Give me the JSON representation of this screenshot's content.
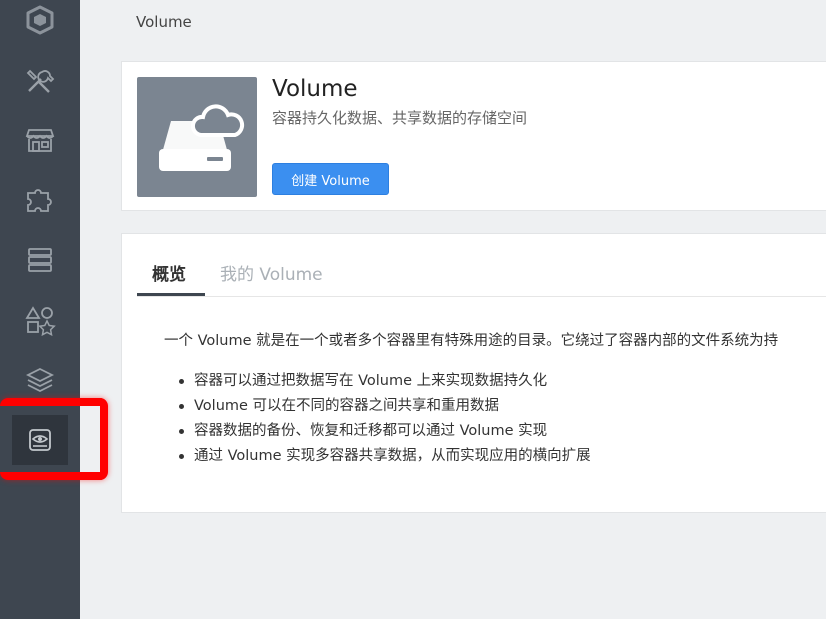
{
  "breadcrumb": "Volume",
  "header": {
    "title": "Volume",
    "subtitle": "容器持久化数据、共享数据的存储空间",
    "create_button": "创建 Volume",
    "icon": "cloud-drive-icon"
  },
  "tabs": [
    {
      "label": "概览",
      "active": true
    },
    {
      "label": "我的 Volume",
      "active": false
    }
  ],
  "content": {
    "intro": "一个 Volume 就是在一个或者多个容器里有特殊用途的目录。它绕过了容器内部的文件系统为持",
    "bullets": [
      "容器可以通过把数据写在 Volume 上来实现数据持久化",
      "Volume 可以在不同的容器之间共享和重用数据",
      "容器数据的备份、恢复和迁移都可以通过 Volume 实现",
      "通过 Volume 实现多容器共享数据，从而实现应用的横向扩展"
    ]
  },
  "sidebar": {
    "items": [
      {
        "icon": "cube-logo-icon",
        "active": false
      },
      {
        "icon": "tools-icon",
        "active": false
      },
      {
        "icon": "store-icon",
        "active": false
      },
      {
        "icon": "puzzle-icon",
        "active": false
      },
      {
        "icon": "server-stack-icon",
        "active": false
      },
      {
        "icon": "shapes-icon",
        "active": false
      },
      {
        "icon": "layers-icon",
        "active": false
      },
      {
        "icon": "volume-drive-icon",
        "active": true
      }
    ]
  },
  "colors": {
    "sidebar_bg": "#3e4650",
    "accent": "#3b8ff0",
    "highlight": "#ff0000"
  }
}
